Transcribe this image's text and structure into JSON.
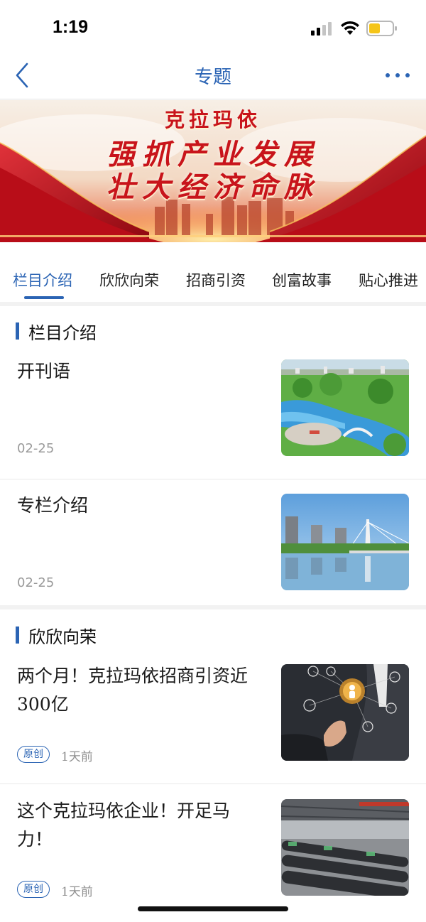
{
  "status_bar": {
    "time": "1:19"
  },
  "nav": {
    "title": "专题"
  },
  "banner": {
    "line1": "克拉玛依",
    "line2": "强抓产业发展",
    "line3": "壮大经济命脉"
  },
  "tabs": [
    {
      "label": "栏目介绍",
      "active": true
    },
    {
      "label": "欣欣向荣",
      "active": false
    },
    {
      "label": "招商引资",
      "active": false
    },
    {
      "label": "创富故事",
      "active": false
    },
    {
      "label": "贴心推进",
      "active": false
    }
  ],
  "sections": [
    {
      "title": "栏目介绍",
      "items": [
        {
          "headline": "开刊语",
          "date": "02-25",
          "image": "park-aerial-image"
        },
        {
          "headline": "专栏介绍",
          "date": "02-25",
          "image": "city-bridge-image"
        }
      ]
    },
    {
      "title": "欣欣向荣",
      "items": [
        {
          "headline": "两个月！克拉玛依招商引资近300亿",
          "badge": "原创",
          "ago": "1天前",
          "image": "business-network-image"
        },
        {
          "headline": "这个克拉玛依企业！开足马力！",
          "badge": "原创",
          "ago": "1天前",
          "image": "factory-pipes-image"
        }
      ]
    }
  ],
  "colors": {
    "accent": "#2b64b4",
    "banner_red": "#c8141b"
  }
}
